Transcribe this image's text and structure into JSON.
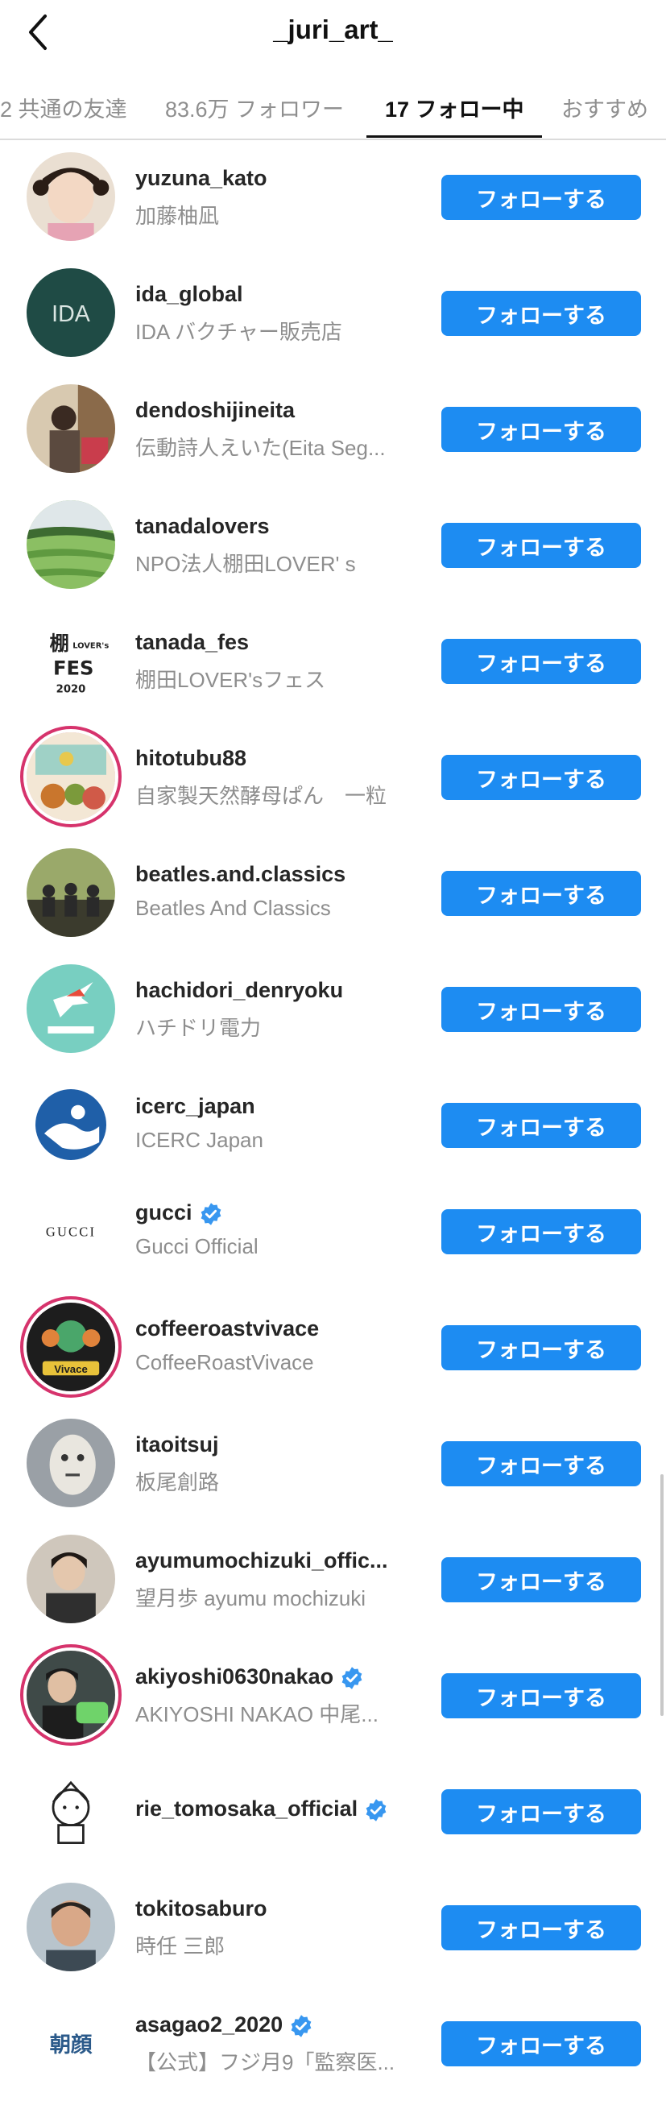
{
  "header": {
    "title": "_juri_art_",
    "back_icon": "chevron-left-icon"
  },
  "tabs": [
    {
      "label": "2 共通の友達",
      "active": false
    },
    {
      "label": "83.6万 フォロワー",
      "active": false
    },
    {
      "label": "17 フォロー中",
      "active": true
    },
    {
      "label": "おすすめ",
      "active": false
    }
  ],
  "follow_label": "フォローする",
  "accent_color": "#1d8cf2",
  "accounts": [
    {
      "username": "yuzuna_kato",
      "display_name": "加藤柚凪",
      "verified": false
    },
    {
      "username": "ida_global",
      "display_name": "IDA バクチャー販売店",
      "verified": false
    },
    {
      "username": "dendoshijineita",
      "display_name": "伝動詩人えいた(Eita Seg...",
      "verified": false
    },
    {
      "username": "tanadalovers",
      "display_name": "NPO法人棚田LOVER' s",
      "verified": false
    },
    {
      "username": "tanada_fes",
      "display_name": "棚田LOVER'sフェス",
      "verified": false
    },
    {
      "username": "hitotubu88",
      "display_name": "自家製天然酵母ぱん　一粒",
      "verified": false
    },
    {
      "username": "beatles.and.classics",
      "display_name": "Beatles And Classics",
      "verified": false
    },
    {
      "username": "hachidori_denryoku",
      "display_name": "ハチドリ電力",
      "verified": false
    },
    {
      "username": "icerc_japan",
      "display_name": "ICERC Japan",
      "verified": false
    },
    {
      "username": "gucci",
      "display_name": "Gucci Official",
      "verified": true
    },
    {
      "username": "coffeeroastvivace",
      "display_name": "CoffeeRoastVivace",
      "verified": false
    },
    {
      "username": "itaoitsuj",
      "display_name": "板尾創路",
      "verified": false
    },
    {
      "username": "ayumumochizuki_offic...",
      "display_name": "望月歩 ayumu mochizuki",
      "verified": false
    },
    {
      "username": "akiyoshi0630nakao",
      "display_name": "AKIYOSHI NAKAO 中尾...",
      "verified": true
    },
    {
      "username": "rie_tomosaka_official",
      "display_name": "",
      "verified": true
    },
    {
      "username": "tokitosaburo",
      "display_name": "時任 三郎",
      "verified": false
    },
    {
      "username": "asagao2_2020",
      "display_name": "【公式】フジ月9「監察医...",
      "verified": true
    }
  ],
  "avatar_text": {
    "ida_global": "IDA",
    "gucci": "GUCCI",
    "tanada_fes": "2020",
    "coffeeroastvivace": "Vivace",
    "asagao2_2020": "朝顔"
  }
}
